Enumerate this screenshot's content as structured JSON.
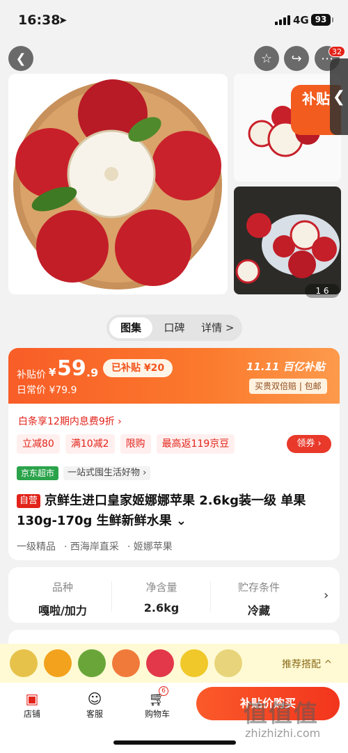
{
  "status": {
    "time": "16:38",
    "network": "4G",
    "battery": "93"
  },
  "nav": {
    "back_icon": "back-arrow-icon",
    "favorite_icon": "star-icon",
    "share_icon": "share-icon",
    "more_icon": "more-icon",
    "more_badge": "32"
  },
  "gallery": {
    "thumb_tag": "补贴",
    "page_indicator": "1 6"
  },
  "tabs": [
    {
      "label": "图集"
    },
    {
      "label": "口碑"
    },
    {
      "label": "详情 >"
    }
  ],
  "price": {
    "subsidy_label": "补贴价",
    "currency": "¥",
    "subsidy_int": "59",
    "subsidy_dec": ".9",
    "daily_label": "日常价 ¥79.9",
    "subsidized": "已补贴 ¥20",
    "event": "11.11 百亿补贴",
    "guarantee": "买贵双倍赔 | 包邮"
  },
  "promo": {
    "baitiao": "白条享12期内息费9折 ›",
    "coupons": [
      "立减80",
      "满10减2",
      "限购",
      "最高返119京豆"
    ],
    "get_coupon": "领券 ›"
  },
  "store": {
    "badge": "京东超市",
    "slogan": "一站式囤生活好物 ›"
  },
  "product": {
    "self_op": "自营",
    "title": "京鲜生进口皇家姬娜娜苹果 2.6kg装一级 单果130g-170g 生鲜新鲜水果 ⌄",
    "tags": [
      "一级精品",
      "· 西海岸直采",
      "· 姬娜苹果"
    ]
  },
  "specs": [
    {
      "key": "品种",
      "value": "嘎啦/加力"
    },
    {
      "key": "净含量",
      "value": "2.6kg"
    },
    {
      "key": "贮存条件",
      "value": "冷藏"
    }
  ],
  "recommend": {
    "label": "推荐搭配 ^"
  },
  "bottom": {
    "store": "店铺",
    "service": "客服",
    "cart": "购物车",
    "cart_count": "6",
    "buy": "补贴价购买"
  },
  "watermark": {
    "logo": "值值值",
    "url": "zhizhizhi.com"
  }
}
